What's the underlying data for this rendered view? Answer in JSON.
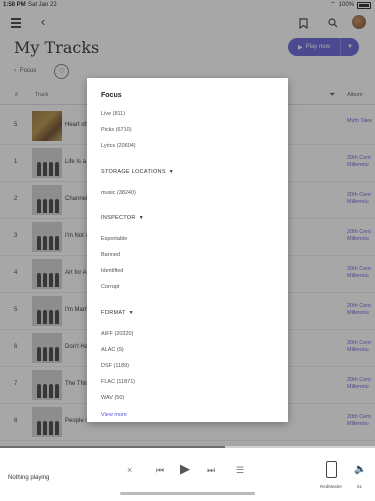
{
  "status_bar": {
    "time": "1:58 PM",
    "date": "Sat Jan 22",
    "battery": "100%"
  },
  "header": {
    "title": "My Tracks",
    "play_label": "Play now"
  },
  "filter": {
    "active": "Focus"
  },
  "table": {
    "columns": {
      "number": "#",
      "track": "Track",
      "album": "Album"
    },
    "rows": [
      {
        "num": "5",
        "title": "Heart of",
        "album": "Myth Take"
      },
      {
        "num": "1",
        "title": "Life Is a",
        "album": "20th Cent\nMillenniu"
      },
      {
        "num": "2",
        "title": "Channel",
        "album": "20th Cent\nMillenniu"
      },
      {
        "num": "3",
        "title": "I'm Not i",
        "album": "20th Cent\nMillenniu"
      },
      {
        "num": "4",
        "title": "Art for A",
        "album": "20th Cent\nMillenniu"
      },
      {
        "num": "5",
        "title": "I'm Marr",
        "album": "20th Cent\nMillenniu"
      },
      {
        "num": "6",
        "title": "Don't Ha",
        "album": "20th Cent\nMillenniu"
      },
      {
        "num": "7",
        "title": "The Thir",
        "album": "20th Cent\nMillenniu"
      },
      {
        "num": "8",
        "title": "People in",
        "album": "20th Cent\nMillenniu"
      }
    ]
  },
  "dialog": {
    "title": "Focus",
    "focus_options": [
      "Live (811)",
      "Picks (6710)",
      "Lyrics (20604)"
    ],
    "storage_label": "STORAGE LOCATIONS",
    "storage_options": [
      "music (38240)"
    ],
    "inspector_label": "INSPECTOR",
    "inspector_options": [
      "Exportable",
      "Banned",
      "Identified",
      "Corrupt"
    ],
    "format_label": "FORMAT",
    "format_options": [
      "AIFF (20320)",
      "ALAC (9)",
      "DSF (1189)",
      "FLAC (11871)",
      "WAV (50)"
    ],
    "view_more": "View more"
  },
  "player": {
    "status": "Nothing playing",
    "progress": 0.6,
    "device_label": "RedMaster",
    "volume_label": "51"
  },
  "colors": {
    "accent": "#5a55d6"
  }
}
